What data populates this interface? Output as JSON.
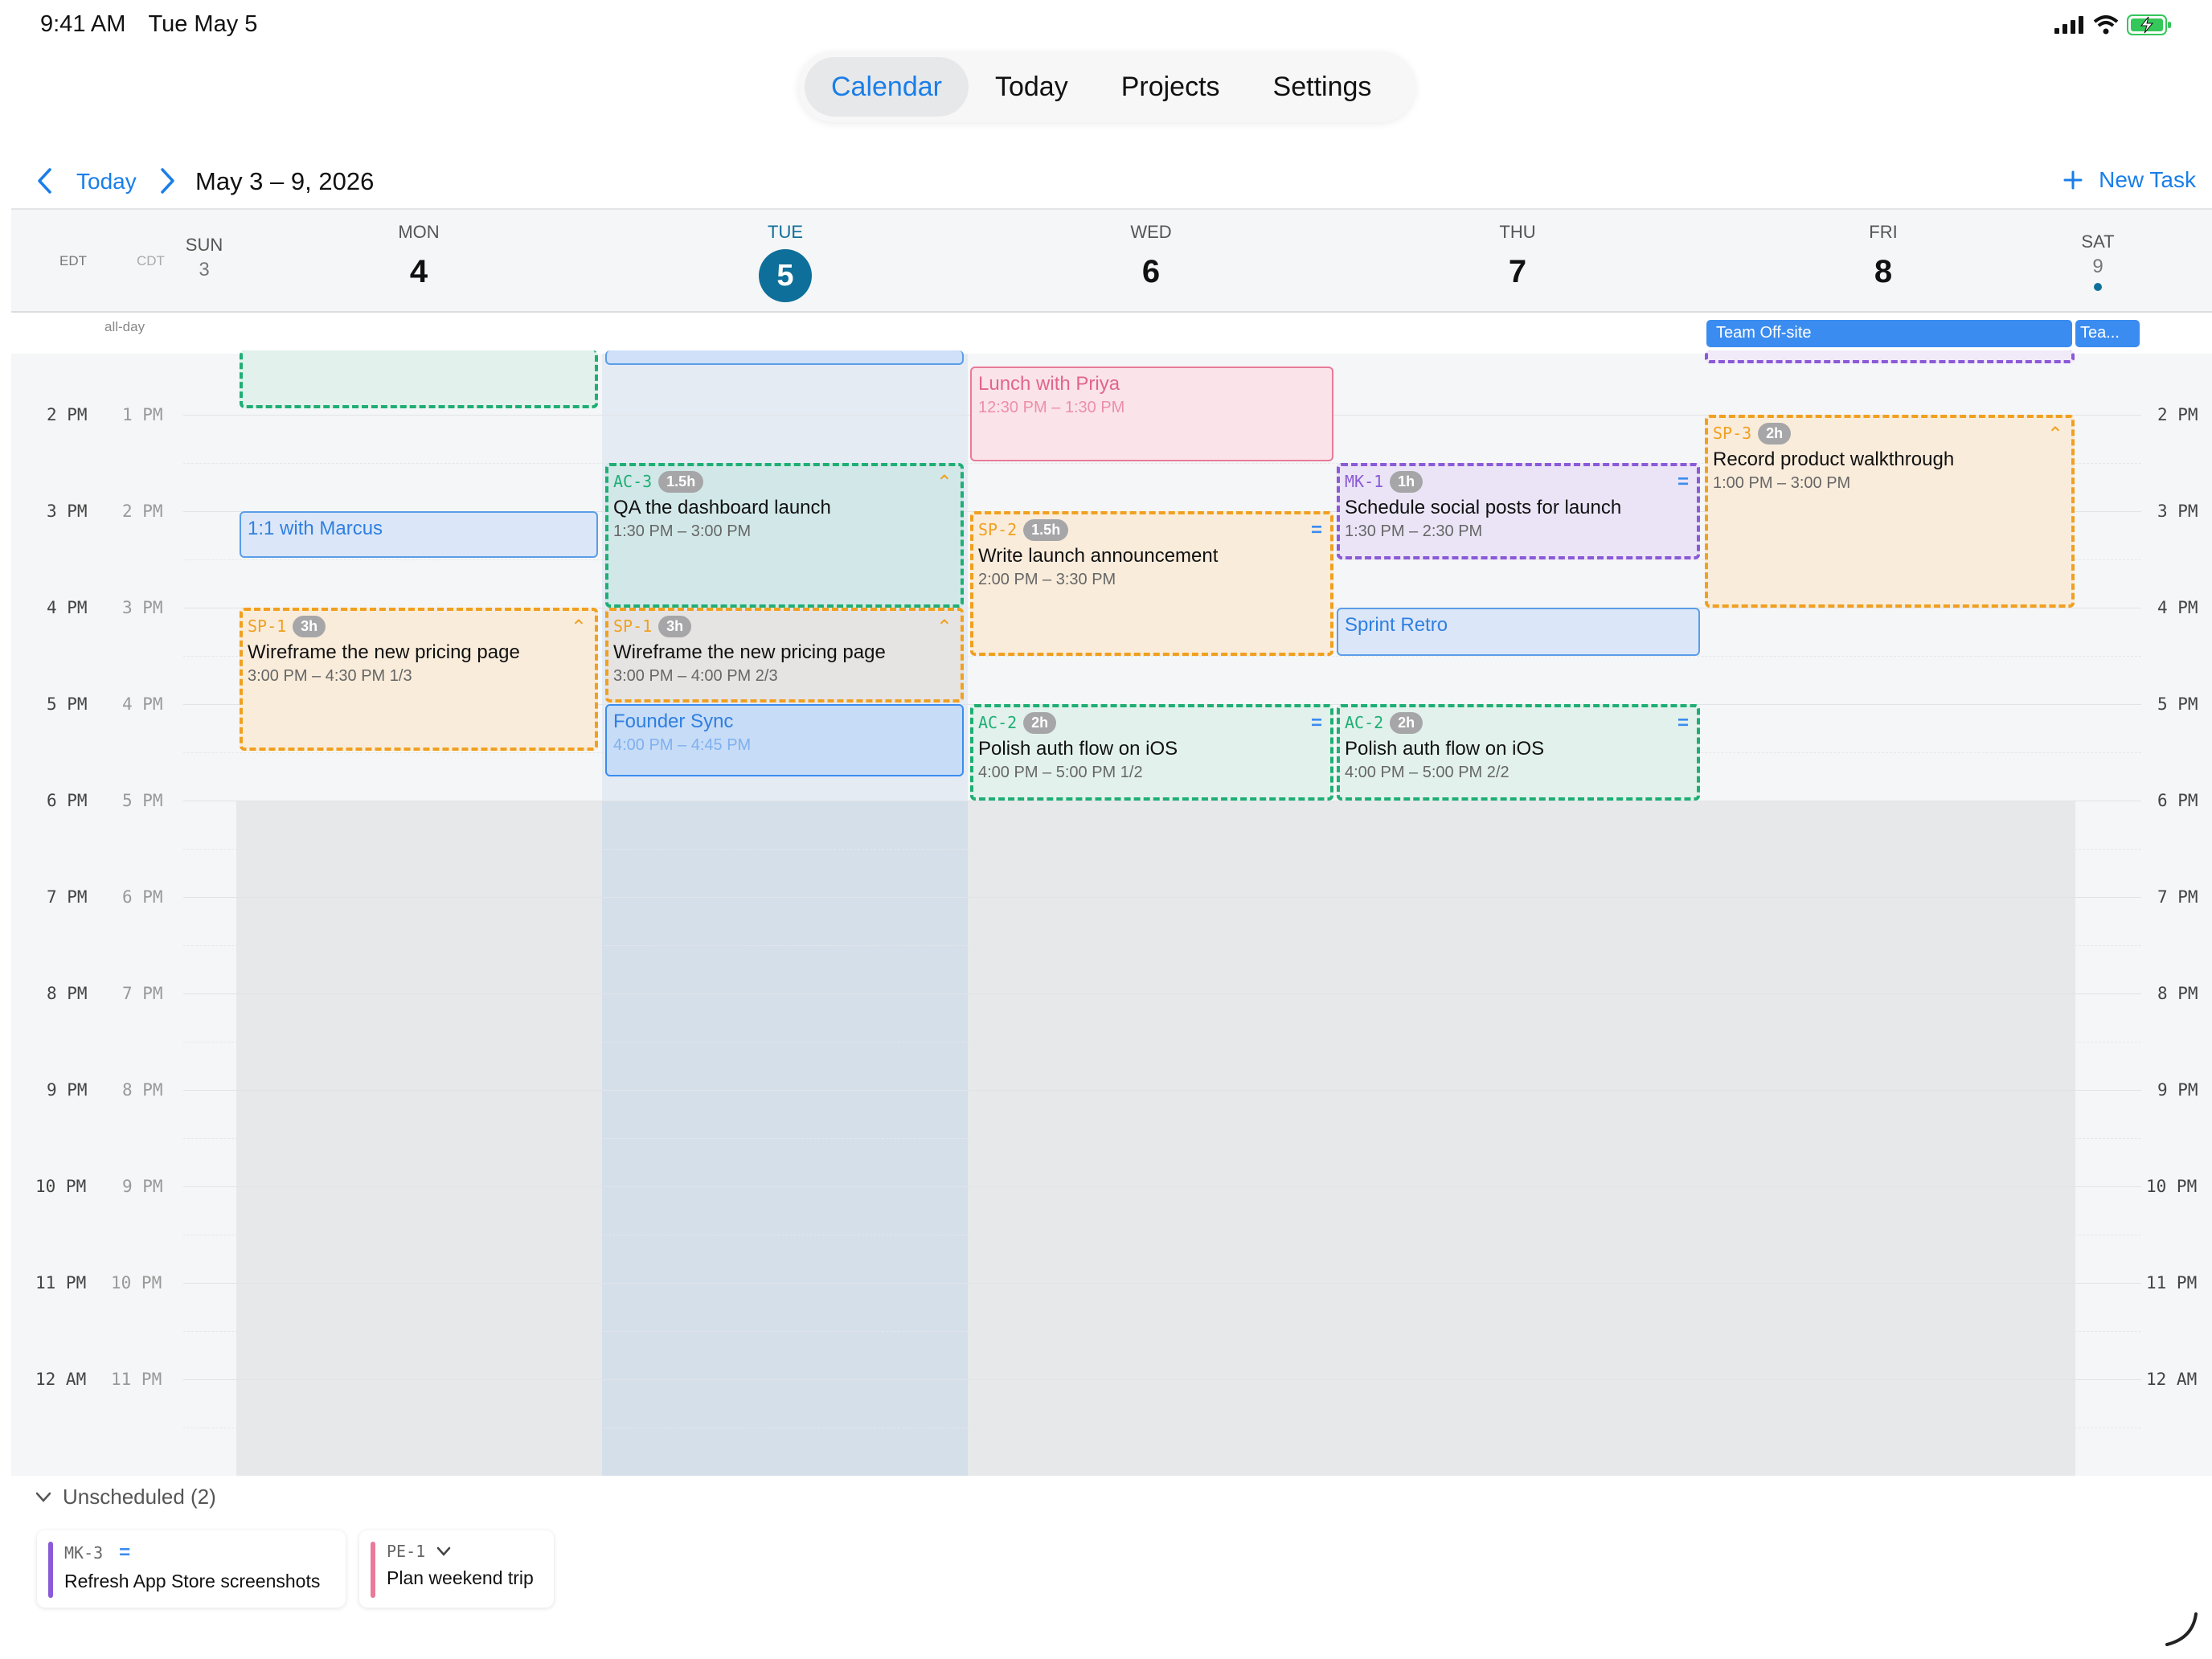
{
  "status_bar": {
    "time": "9:41 AM",
    "date": "Tue May 5"
  },
  "nav": {
    "tabs": [
      "Calendar",
      "Today",
      "Projects",
      "Settings"
    ],
    "active": "Calendar"
  },
  "toolbar": {
    "today": "Today",
    "range": "May 3 – 9, 2026",
    "new_task": "New Task"
  },
  "timezones": {
    "primary": "EDT",
    "secondary": "CDT"
  },
  "days": [
    {
      "name": "SUN",
      "num": "3"
    },
    {
      "name": "MON",
      "num": "4"
    },
    {
      "name": "TUE",
      "num": "5",
      "today": true
    },
    {
      "name": "WED",
      "num": "6"
    },
    {
      "name": "THU",
      "num": "7"
    },
    {
      "name": "FRI",
      "num": "8"
    },
    {
      "name": "SAT",
      "num": "9"
    }
  ],
  "allday_label": "all-day",
  "allday_events": [
    {
      "title": "Team Off-site"
    },
    {
      "title": "Tea..."
    }
  ],
  "hours_primary": [
    "2 PM",
    "3 PM",
    "4 PM",
    "5 PM",
    "6 PM",
    "7 PM",
    "8 PM",
    "9 PM",
    "10 PM",
    "11 PM",
    "12 AM"
  ],
  "hours_secondary": [
    "1 PM",
    "2 PM",
    "3 PM",
    "4 PM",
    "5 PM",
    "6 PM",
    "7 PM",
    "8 PM",
    "9 PM",
    "10 PM",
    "11 PM"
  ],
  "events": {
    "lunch_priya": {
      "title": "Lunch with Priya",
      "time": "12:30 PM – 1:30 PM"
    },
    "one_on_one": {
      "title": "1:1 with Marcus"
    },
    "qa_dashboard": {
      "code": "AC-3",
      "dur": "1.5h",
      "title": "QA the dashboard launch",
      "time": "1:30 PM – 3:00 PM"
    },
    "wireframe_mon": {
      "code": "SP-1",
      "dur": "3h",
      "title": "Wireframe the new pricing page",
      "time": "3:00 PM – 4:30 PM  1/3"
    },
    "wireframe_tue": {
      "code": "SP-1",
      "dur": "3h",
      "title": "Wireframe the new pricing page",
      "time": "3:00 PM – 4:00 PM  2/3"
    },
    "founder_sync": {
      "title": "Founder Sync",
      "time": "4:00 PM – 4:45 PM"
    },
    "write_announcement": {
      "code": "SP-2",
      "dur": "1.5h",
      "title": "Write launch announcement",
      "time": "2:00 PM – 3:30 PM"
    },
    "polish_auth_wed": {
      "code": "AC-2",
      "dur": "2h",
      "title": "Polish auth flow on iOS",
      "time": "4:00 PM – 5:00 PM  1/2"
    },
    "schedule_social": {
      "code": "MK-1",
      "dur": "1h",
      "title": "Schedule social posts for launch",
      "time": "1:30 PM – 2:30 PM"
    },
    "sprint_retro": {
      "title": "Sprint Retro"
    },
    "polish_auth_thu": {
      "code": "AC-2",
      "dur": "2h",
      "title": "Polish auth flow on iOS",
      "time": "4:00 PM – 5:00 PM  2/2"
    },
    "record_walkthrough": {
      "code": "SP-3",
      "dur": "2h",
      "title": "Record product walkthrough",
      "time": "1:00 PM – 3:00 PM"
    }
  },
  "unscheduled": {
    "header": "Unscheduled (2)",
    "items": [
      {
        "code": "MK-3",
        "title": "Refresh App Store screenshots"
      },
      {
        "code": "PE-1",
        "title": "Plan weekend trip"
      }
    ]
  },
  "colors": {
    "accent": "#1a7ee8",
    "today_circle": "#0e6f9a",
    "orange": "#f0a020",
    "green": "#1fae74",
    "purple": "#8a5ad8",
    "pink": "#e87a9a",
    "blue_event": "#3b8cf0"
  }
}
